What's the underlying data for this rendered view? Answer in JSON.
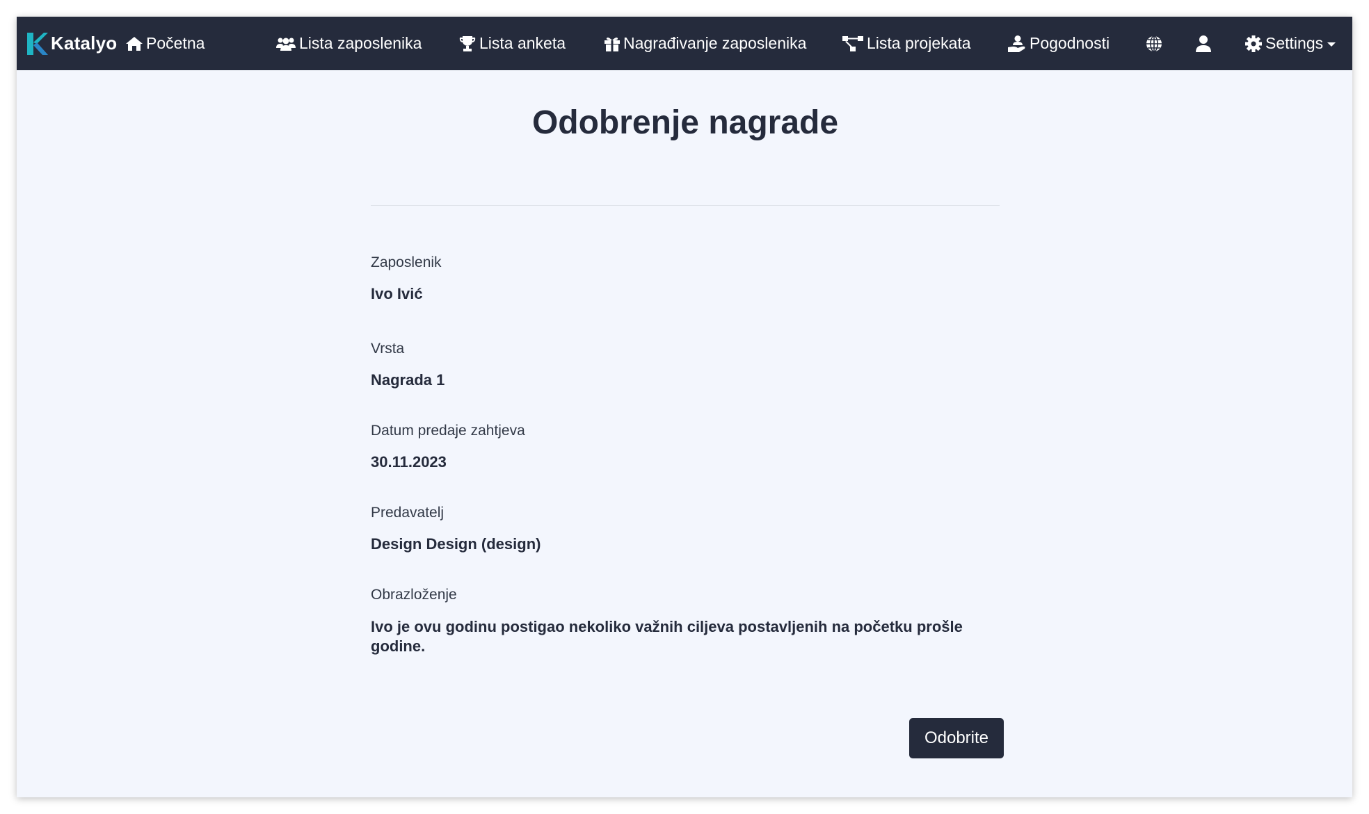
{
  "navbar": {
    "brand": "Katalyo",
    "items": [
      {
        "label": "Početna",
        "icon": "home-icon"
      },
      {
        "label": "Lista zaposlenika",
        "icon": "users-icon"
      },
      {
        "label": "Lista anketa",
        "icon": "trophy-icon"
      },
      {
        "label": "Nagrađivanje zaposlenika",
        "icon": "gift-icon"
      },
      {
        "label": "Lista projekata",
        "icon": "sitemap-icon"
      },
      {
        "label": "Pogodnosti",
        "icon": "hand-holding-user-icon"
      }
    ],
    "language_icon": "globe-icon",
    "user_icon": "user-icon",
    "settings": {
      "label": "Settings",
      "icon": "gear-icon"
    }
  },
  "page": {
    "title": "Odobrenje nagrade"
  },
  "fields": [
    {
      "label": "Zaposlenik",
      "value": "Ivo Ivić"
    },
    {
      "label": "Vrsta",
      "value": "Nagrada 1"
    },
    {
      "label": "Datum predaje zahtjeva",
      "value": "30.11.2023"
    },
    {
      "label": "Predavatelj",
      "value": "Design Design (design)"
    },
    {
      "label": "Obrazloženje",
      "value": "Ivo je ovu godinu postigao nekoliko važnih ciljeva postavljenih na početku prošle godine."
    }
  ],
  "actions": {
    "approve_label": "Odobrite"
  },
  "colors": {
    "navbar_bg": "#252b3c",
    "page_bg": "#f3f6fd",
    "brand_accent": "#1fb5c4",
    "button_bg": "#252b3c"
  }
}
